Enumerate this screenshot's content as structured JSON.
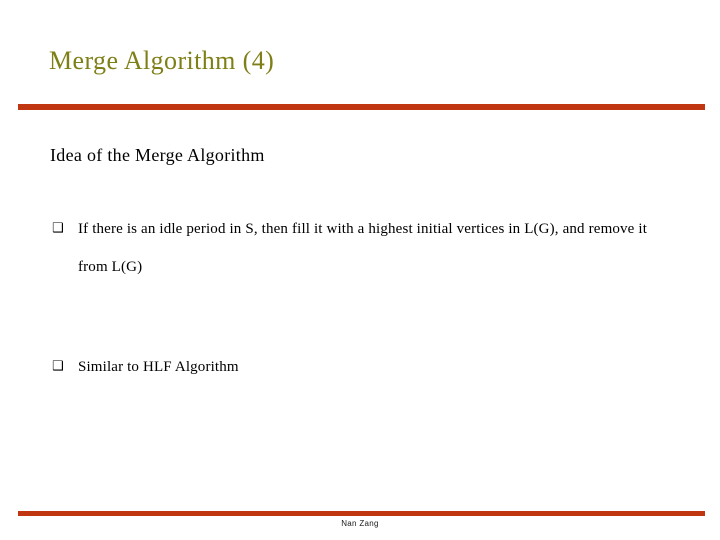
{
  "slide": {
    "title": "Merge Algorithm (4)",
    "accent_color": "#bf3611",
    "title_color": "#7f7f17",
    "background_color": "#ffffff",
    "body_text_color": "#000000"
  },
  "body": {
    "heading": "Idea of the Merge Algorithm",
    "bullet_marker": "❑",
    "bullets": [
      {
        "marker": "❑",
        "text": "If there is an idle period in S, then fill it with a highest initial vertices in L(G), and remove it from L(G)"
      },
      {
        "marker": "❑",
        "text": "Similar to HLF Algorithm"
      }
    ]
  },
  "footer": {
    "author": "Nan Zang"
  }
}
